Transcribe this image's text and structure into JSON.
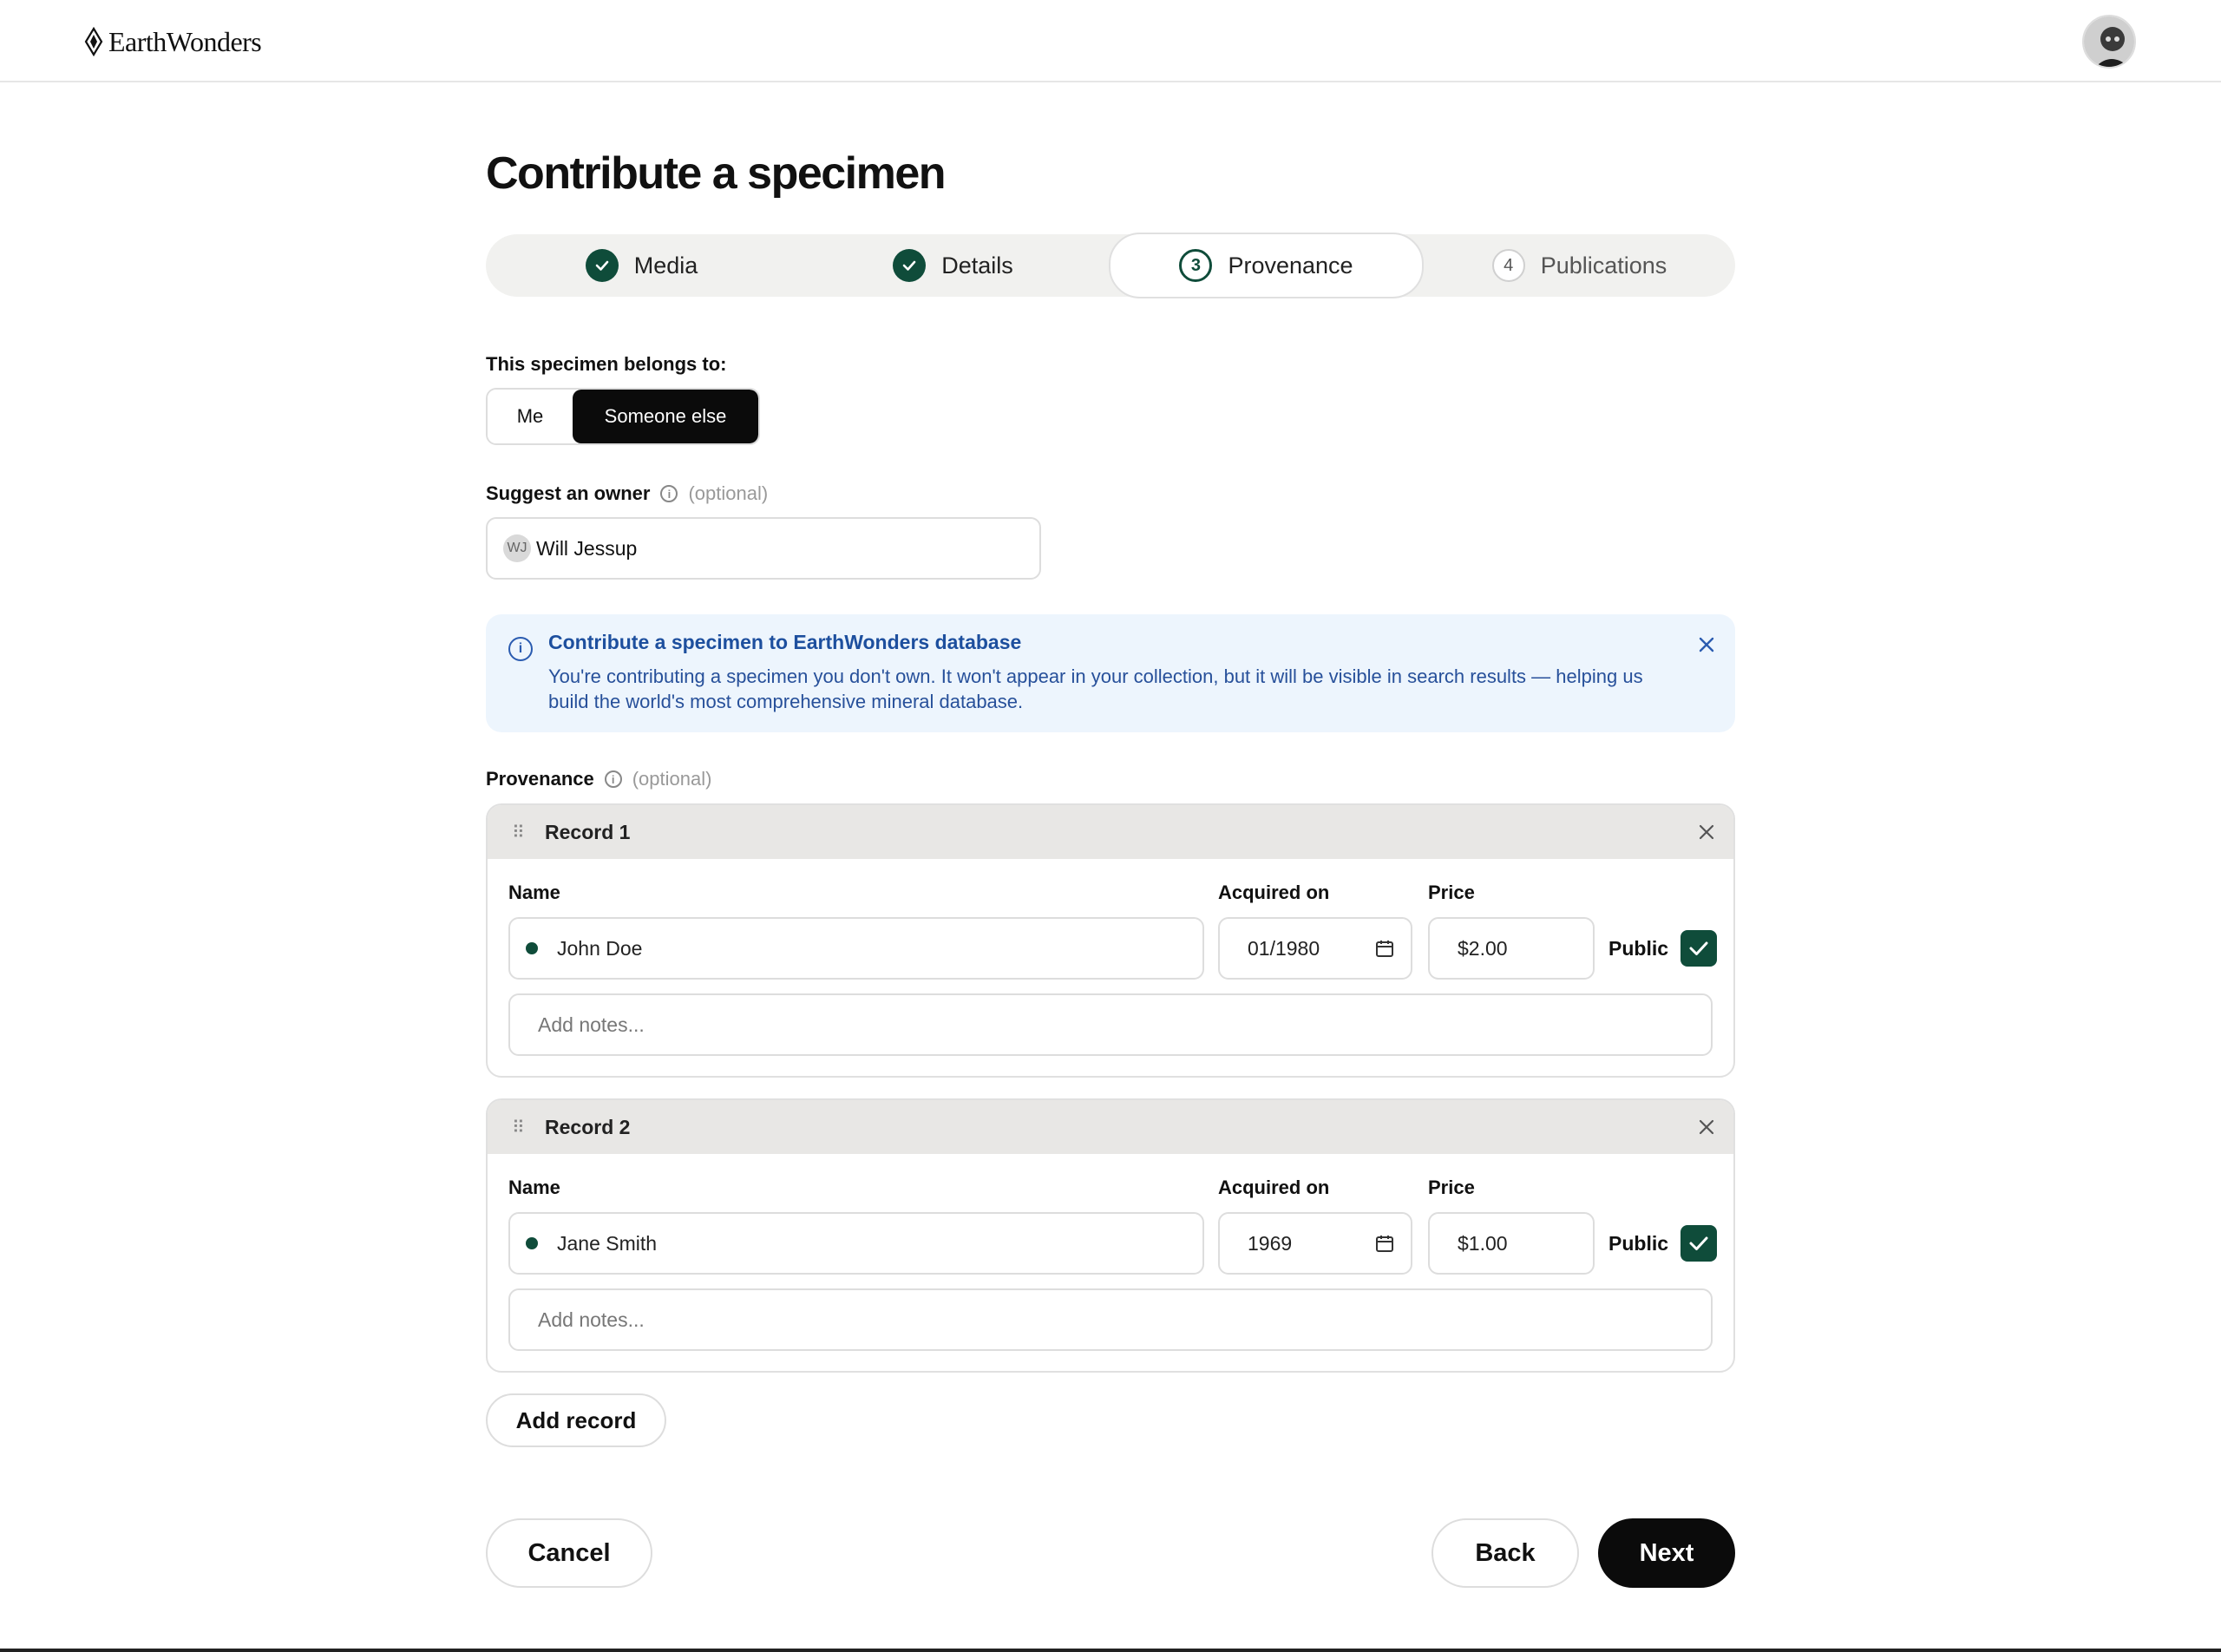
{
  "header": {
    "logo_text": "EarthWonders",
    "avatar_alt": "user-avatar"
  },
  "page": {
    "title": "Contribute a specimen"
  },
  "stepper": {
    "steps": [
      {
        "label": "Media",
        "state": "done",
        "number": ""
      },
      {
        "label": "Details",
        "state": "done",
        "number": ""
      },
      {
        "label": "Provenance",
        "state": "current",
        "number": "3"
      },
      {
        "label": "Publications",
        "state": "pending",
        "number": "4"
      }
    ]
  },
  "ownership": {
    "label": "This specimen belongs to:",
    "options": [
      "Me",
      "Someone else"
    ],
    "selected": "Someone else"
  },
  "suggest_owner": {
    "label": "Suggest an owner",
    "optional": "(optional)",
    "initials": "WJ",
    "value": "Will Jessup"
  },
  "notice": {
    "title": "Contribute a specimen to EarthWonders database",
    "body": "You're contributing a specimen you don't own. It won't appear in your collection, but it will be visible in search results — helping us build the world's most comprehensive mineral database."
  },
  "provenance": {
    "label": "Provenance",
    "optional": "(optional)",
    "field_labels": {
      "name": "Name",
      "acquired": "Acquired on",
      "price": "Price",
      "public": "Public"
    },
    "records": [
      {
        "title": "Record 1",
        "name": "John Doe",
        "acquired_on": "01/1980",
        "price": "$2.00",
        "public": true,
        "notes_placeholder": "Add notes..."
      },
      {
        "title": "Record 2",
        "name": "Jane Smith",
        "acquired_on": "1969",
        "price": "$1.00",
        "public": true,
        "notes_placeholder": "Add notes..."
      }
    ],
    "add_record_label": "Add record"
  },
  "footer": {
    "cancel_label": "Cancel",
    "back_label": "Back",
    "next_label": "Next"
  },
  "colors": {
    "accent_green": "#0f4c3a",
    "primary_button": "#0b0b0b",
    "notice_bg": "#edf5fd",
    "notice_text": "#1d4f9e"
  }
}
